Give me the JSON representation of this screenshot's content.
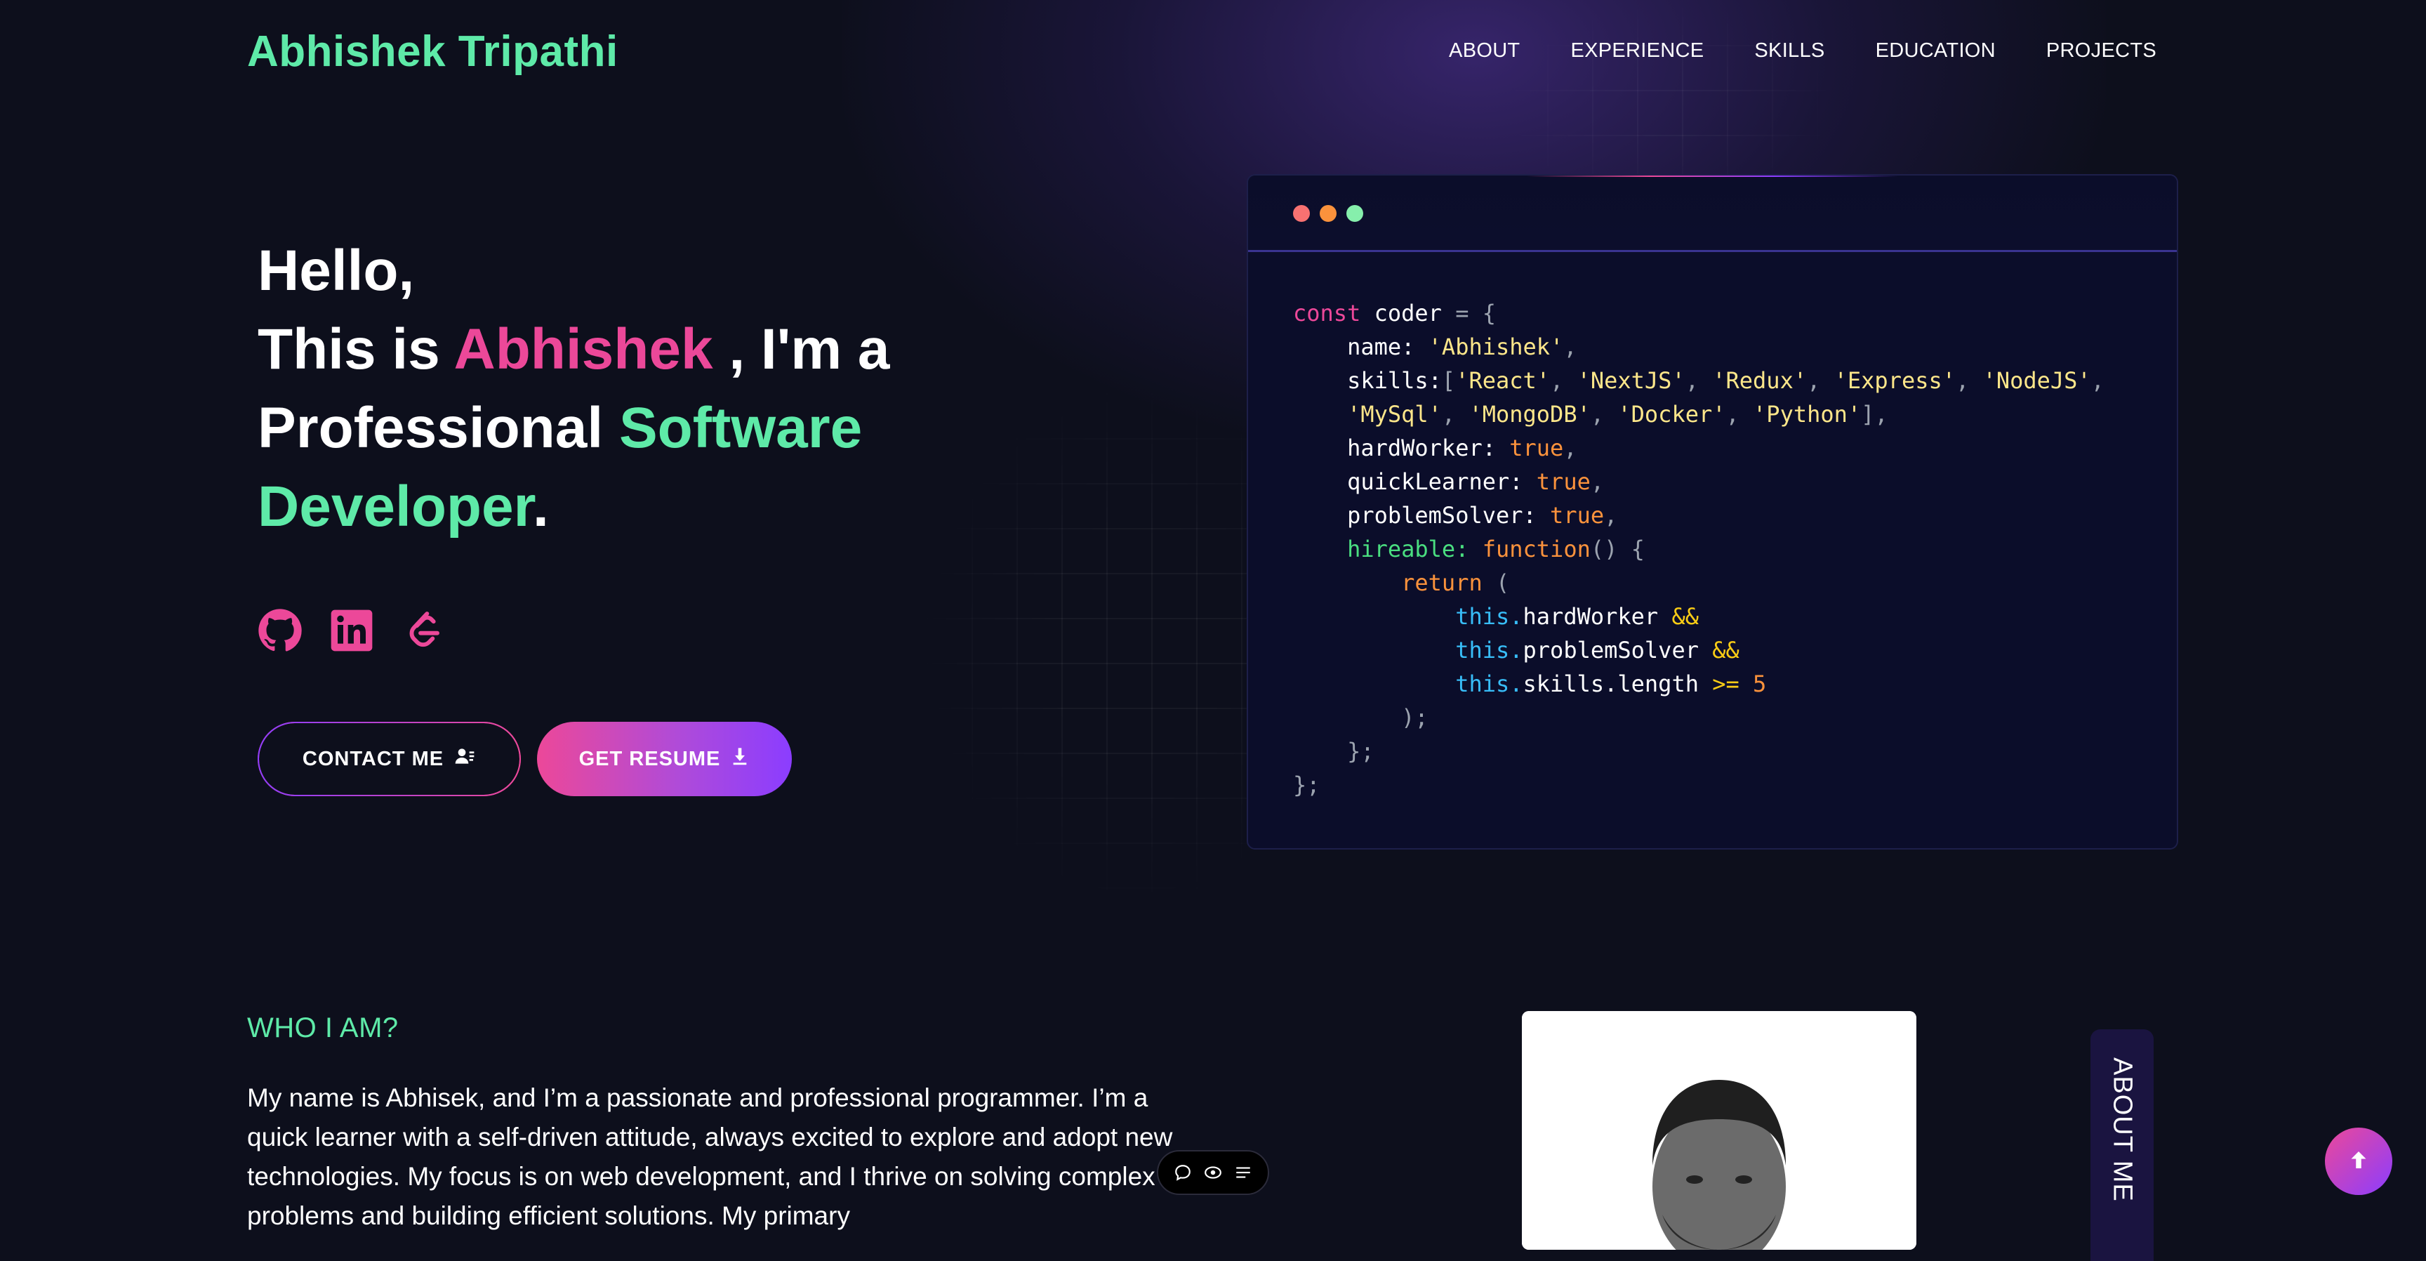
{
  "header": {
    "brand": "Abhishek Tripathi",
    "nav": [
      "ABOUT",
      "EXPERIENCE",
      "SKILLS",
      "EDUCATION",
      "PROJECTS"
    ]
  },
  "hero": {
    "line1": "Hello,",
    "line2_pre": "This is ",
    "line2_name": "Abhishek",
    "line2_post": " , I'm a",
    "line3_pre": "Professional ",
    "line3_accent": "Software",
    "line4_accent": "Developer",
    "line4_post": "."
  },
  "socials": [
    "github-icon",
    "linkedin-icon",
    "leetcode-icon"
  ],
  "buttons": {
    "contact": "CONTACT ME",
    "resume": "GET RESUME"
  },
  "code": {
    "kw_const": "const",
    "var_name": " coder ",
    "eq": "= {",
    "name_key": "name: ",
    "name_val": "'Abhishek'",
    "skills_key": "skills:",
    "skills": [
      "'React'",
      "'NextJS'",
      "'Redux'",
      "'Express'",
      "'NodeJS'",
      "'MySql'",
      "'MongoDB'",
      "'Docker'",
      "'Python'"
    ],
    "hardWorker": "hardWorker: ",
    "quickLearner": "quickLearner: ",
    "problemSolver": "problemSolver: ",
    "true_val": "true",
    "hireable": "hireable:",
    "function_kw": " function",
    "return_kw": "return",
    "this_kw": "this.",
    "hw_prop": "hardWorker ",
    "ps_prop": "problemSolver ",
    "len_prop": "skills.length ",
    "and_op": "&&",
    "gte_op": ">=",
    "five": "5"
  },
  "about": {
    "heading": "WHO I AM?",
    "paragraph": "My name is Abhisek, and I’m a passionate and professional programmer. I’m a quick learner with a self-driven attitude, always excited to explore and adopt new technologies. My focus is on web development, and I thrive on solving complex problems and building efficient solutions. My primary",
    "side_tab": "ABOUT ME"
  },
  "colors": {
    "accent_green": "#5eeaa8",
    "accent_pink": "#ec4899",
    "accent_purple": "#8b3dff",
    "background": "#0d0f1c"
  }
}
